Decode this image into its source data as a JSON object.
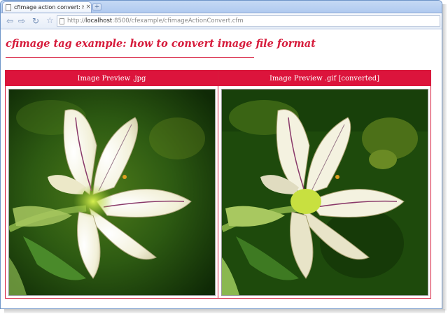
{
  "browser": {
    "tab_title": "cfimage action convert: ho...",
    "tab_close": "×",
    "new_tab": "+",
    "url_prefix": "http://",
    "url_host": "localhost",
    "url_rest": ":8500/cfexample/cfimageActionConvert.cfm"
  },
  "page": {
    "title": "cfimage tag example: how to convert image file format",
    "columns": [
      {
        "header": "Image Preview .jpg"
      },
      {
        "header": "Image Preview .gif [converted]"
      }
    ]
  },
  "colors": {
    "accent": "#dc143c",
    "title_text": "#d61b3b"
  }
}
